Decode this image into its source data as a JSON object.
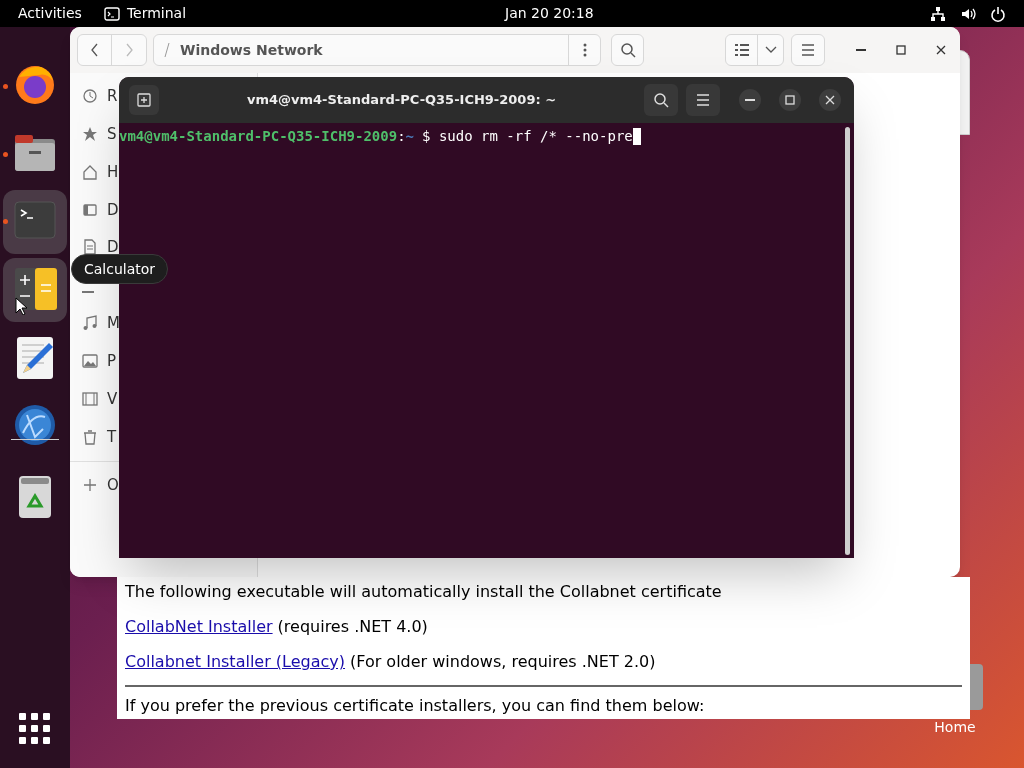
{
  "top_bar": {
    "activities": "Activities",
    "app": "Terminal",
    "clock": "Jan 20  20:18"
  },
  "dock": {
    "items": [
      {
        "kind": "firefox",
        "running": true,
        "highlighted": false
      },
      {
        "kind": "files",
        "running": true,
        "highlighted": false
      },
      {
        "kind": "terminal",
        "running": true,
        "highlighted": true
      },
      {
        "kind": "calculator",
        "running": false,
        "highlighted": true
      },
      {
        "kind": "editor",
        "running": false,
        "highlighted": false
      },
      {
        "kind": "globe",
        "running": false,
        "highlighted": false
      },
      {
        "kind": "trash",
        "running": false,
        "highlighted": false
      }
    ],
    "tooltip": "Calculator"
  },
  "files_window": {
    "path": "Windows Network",
    "sidebar": {
      "items": [
        {
          "kind": "recent",
          "label": "R"
        },
        {
          "kind": "starred",
          "label": "S"
        },
        {
          "kind": "home",
          "label": "H"
        },
        {
          "kind": "desktop",
          "label": "D"
        },
        {
          "kind": "documents",
          "label": "D"
        },
        {
          "kind": "downloads"
        },
        {
          "kind": "music",
          "label": "M"
        },
        {
          "kind": "pictures",
          "label": "P"
        },
        {
          "kind": "videos",
          "label": "V"
        },
        {
          "kind": "trash",
          "label": "T"
        },
        {
          "kind": "other",
          "label": "O"
        }
      ]
    }
  },
  "terminal": {
    "title": "vm4@vm4-Standard-PC-Q35-ICH9-2009: ~",
    "user_host": "vm4@vm4-Standard-PC-Q35-ICH9-2009",
    "separator": ":",
    "path": "~",
    "command": "$ sudo rm -rf /* --no-pre"
  },
  "browser": {
    "intro": "The following executable will automatically install the Collabnet certificate",
    "links": [
      {
        "link": "CollabNet Installer",
        "note": "(requires .NET 4.0)"
      },
      {
        "link": "Collabnet Installer (Legacy)",
        "note": "(For older windows, requires .NET 2.0)"
      }
    ],
    "cut_line": "If you prefer the previous certificate installers, you can find them below:"
  },
  "desktop": {
    "icon_label": "Home"
  }
}
